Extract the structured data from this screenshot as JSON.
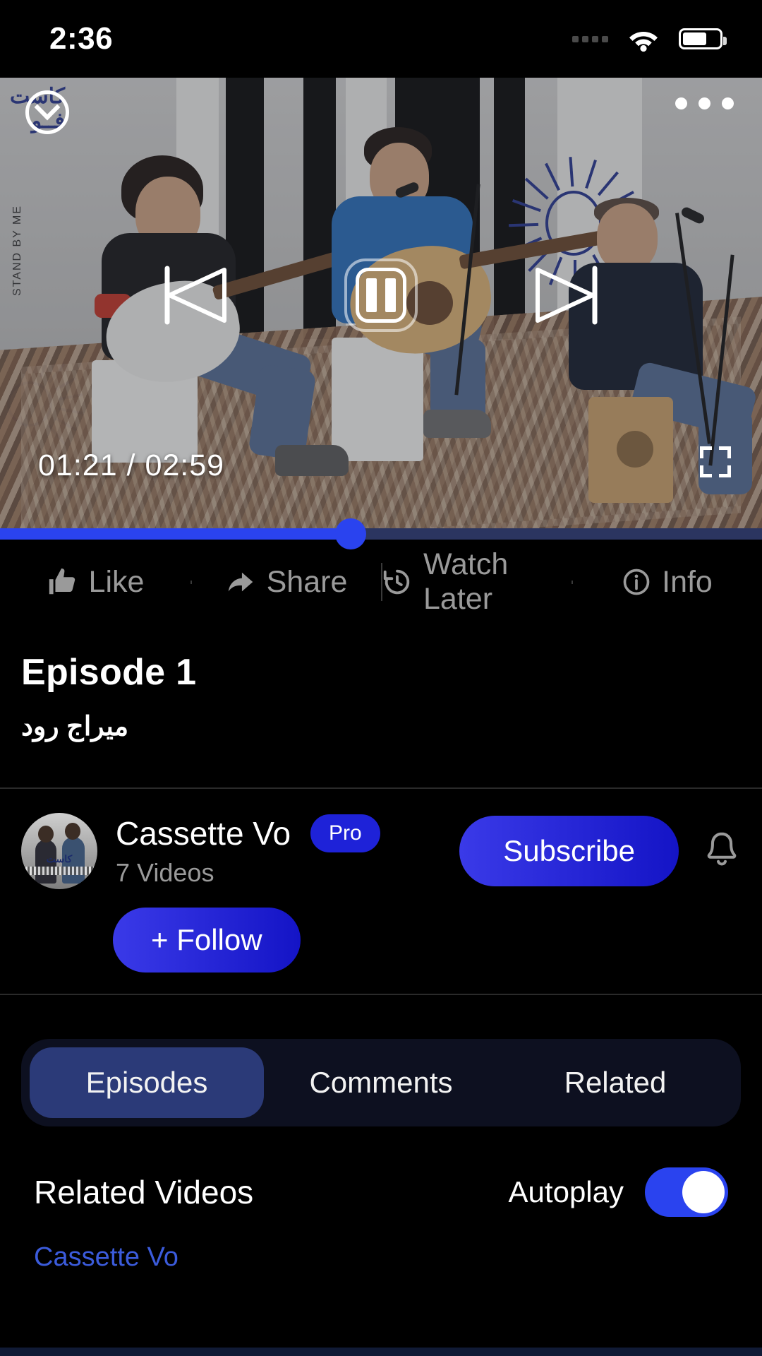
{
  "status_bar": {
    "time": "2:36",
    "wifi_icon": "wifi-icon",
    "battery_icon": "battery-icon",
    "battery_level_percent": 65,
    "signal_icon": "signal-dots-icon"
  },
  "player": {
    "collapse_icon": "chevron-down-icon",
    "more_icon": "more-options-icon",
    "previous_icon": "skip-previous-icon",
    "pause_icon": "pause-icon",
    "next_icon": "skip-next-icon",
    "fullscreen_icon": "fullscreen-icon",
    "current_time": "01:21",
    "separator": "/",
    "duration": "02:59",
    "time_display": "01:21 / 02:59",
    "progress_percent": 46,
    "accent_color": "#2a43ef",
    "track_color": "#2b3560",
    "overlay_logo_text": "کاست\nفــو",
    "overlay_vertical_text": "STAND BY ME"
  },
  "action_bar": [
    {
      "label": "Like",
      "icon": "thumbs-up-icon"
    },
    {
      "label": "Share",
      "icon": "share-arrow-icon"
    },
    {
      "label": "Watch Later",
      "icon": "clock-history-icon"
    },
    {
      "label": "Info",
      "icon": "info-circle-icon"
    }
  ],
  "video_info": {
    "title": "Episode 1",
    "subtitle": "میراج رود"
  },
  "channel": {
    "avatar_icon": "channel-avatar",
    "avatar_caption": "کاست",
    "name": "Cassette Vo",
    "badge": "Pro",
    "video_count": "7 Videos",
    "subscribe_label": "Subscribe",
    "bell_icon": "notification-bell-icon",
    "follow_label": "+ Follow",
    "button_color_start": "#3a3ae8",
    "button_color_end": "#1414c6",
    "badge_color": "#1e22d8"
  },
  "tabs": {
    "items": [
      {
        "label": "Episodes",
        "active": true
      },
      {
        "label": "Comments",
        "active": false
      },
      {
        "label": "Related",
        "active": false
      }
    ],
    "active_color": "#2b3a78",
    "track_color": "#0d1020"
  },
  "related_section": {
    "heading": "Related Videos",
    "autoplay_label": "Autoplay",
    "autoplay_on": true,
    "switch_color": "#2a43ef",
    "link_label": "Cassette Vo",
    "link_color": "#3b5bdb"
  }
}
